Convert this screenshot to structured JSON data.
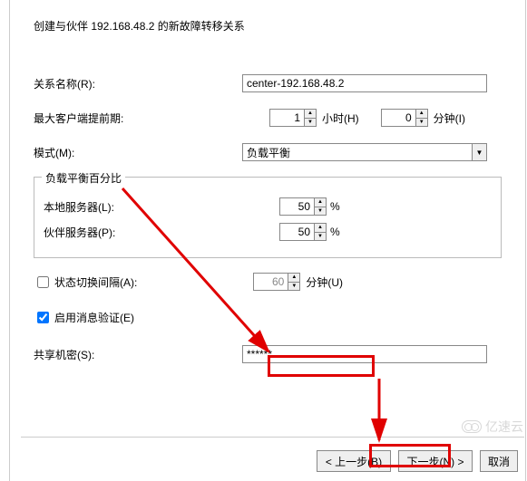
{
  "title": "创建与伙伴 192.168.48.2 的新故障转移关系",
  "labels": {
    "relation_name": "关系名称(R):",
    "max_client_lead": "最大客户端提前期:",
    "hours": "小时(H)",
    "minutes": "分钟(I)",
    "mode": "模式(M):",
    "lb_group": "负载平衡百分比",
    "local_server": "本地服务器(L):",
    "partner_server": "伙伴服务器(P):",
    "state_switch": "状态切换间隔(A):",
    "state_minutes": "分钟(U)",
    "enable_msg_auth": "启用消息验证(E)",
    "shared_secret": "共享机密(S):"
  },
  "values": {
    "relation_name": "center-192.168.48.2",
    "lead_hours": "1",
    "lead_minutes": "0",
    "mode_selected": "负载平衡",
    "local_pct": "50",
    "partner_pct": "50",
    "state_interval": "60",
    "state_switch_checked": false,
    "msg_auth_checked": true,
    "shared_secret": "******"
  },
  "buttons": {
    "back": "< 上一步(B)",
    "next": "下一步(N) >",
    "cancel": "取消"
  },
  "watermark": "亿速云"
}
